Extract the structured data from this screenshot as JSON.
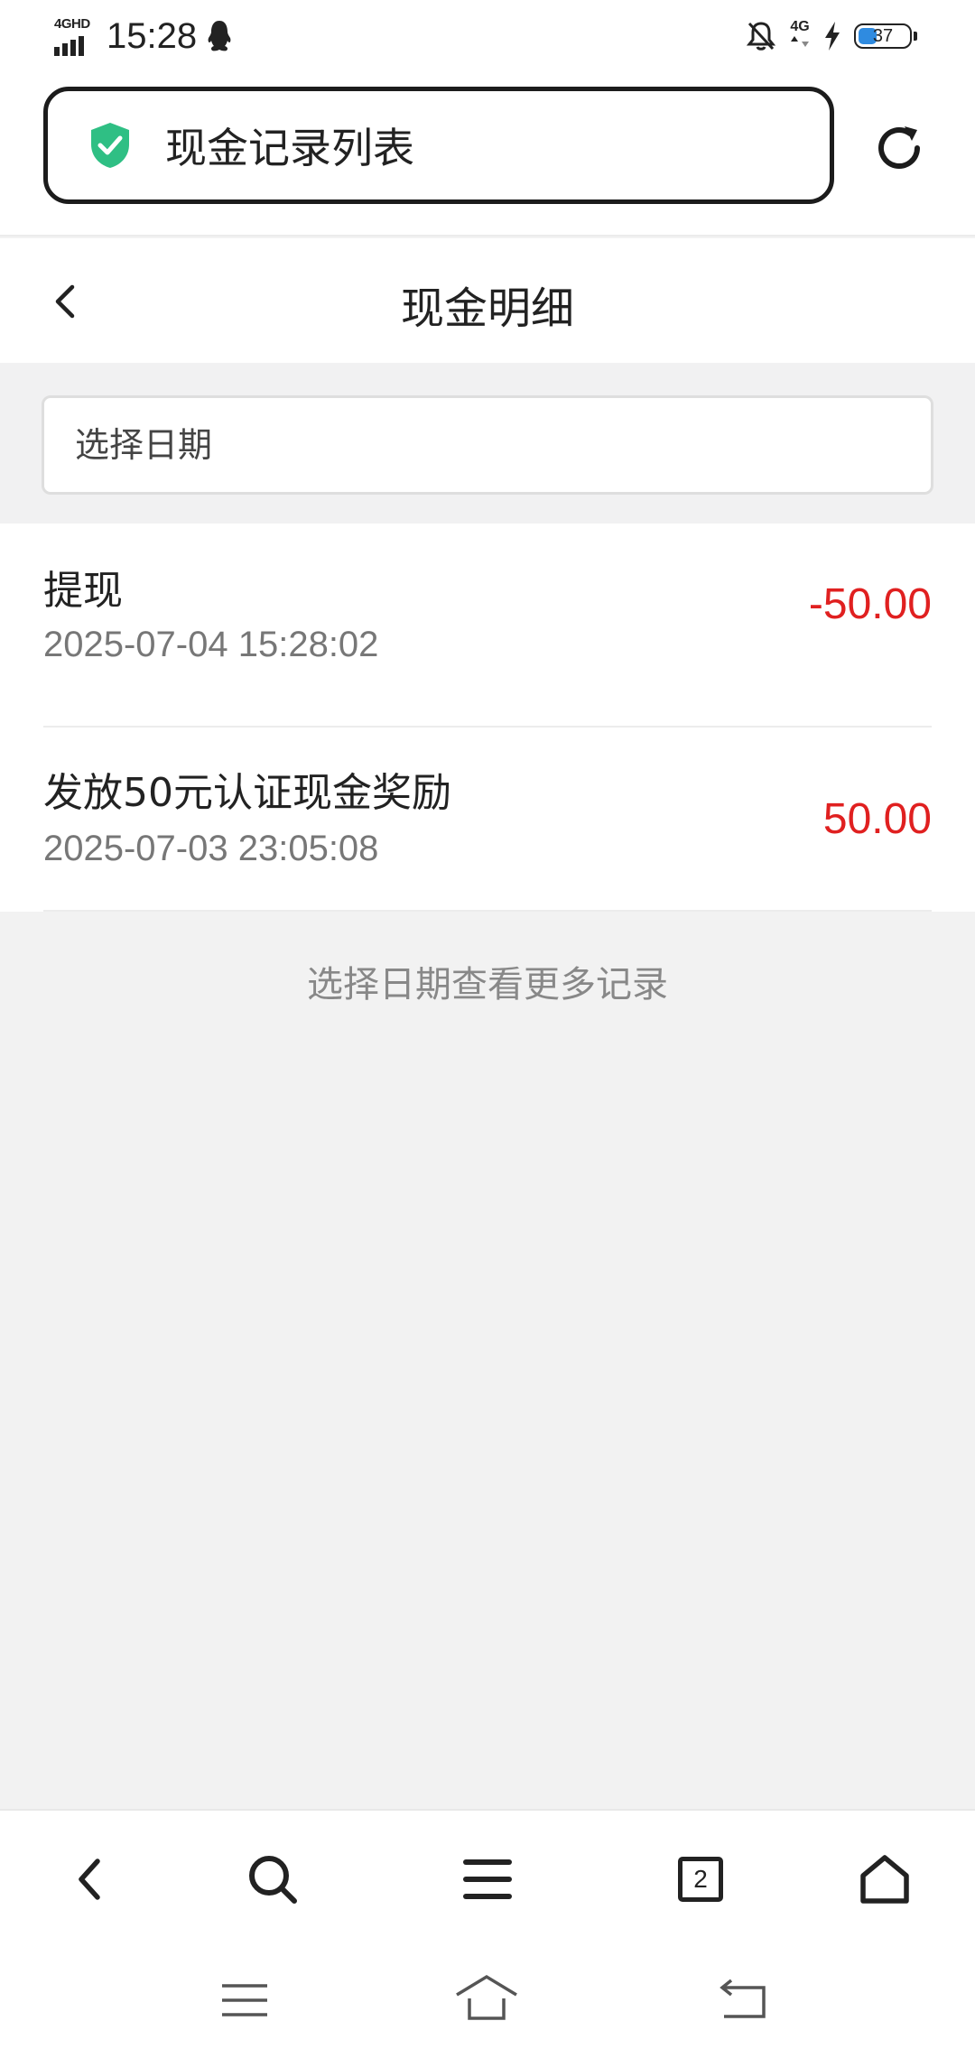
{
  "status_bar": {
    "network_label": "4GHD",
    "time": "15:28",
    "network_right": "4G",
    "battery_level": "37"
  },
  "browser": {
    "address_text": "现金记录列表"
  },
  "page": {
    "title": "现金明细"
  },
  "filter": {
    "placeholder": "选择日期"
  },
  "records": [
    {
      "title": "提现",
      "time": "2025-07-04 15:28:02",
      "amount": "-50.00"
    },
    {
      "title": "发放50元认证现金奖励",
      "time": "2025-07-03 23:05:08",
      "amount": "50.00"
    }
  ],
  "more_hint": "选择日期查看更多记录",
  "toolbar": {
    "tab_count": "2"
  },
  "colors": {
    "amount": "#e02020",
    "shield": "#2fbf84",
    "battery_fill": "#2f8be0"
  }
}
